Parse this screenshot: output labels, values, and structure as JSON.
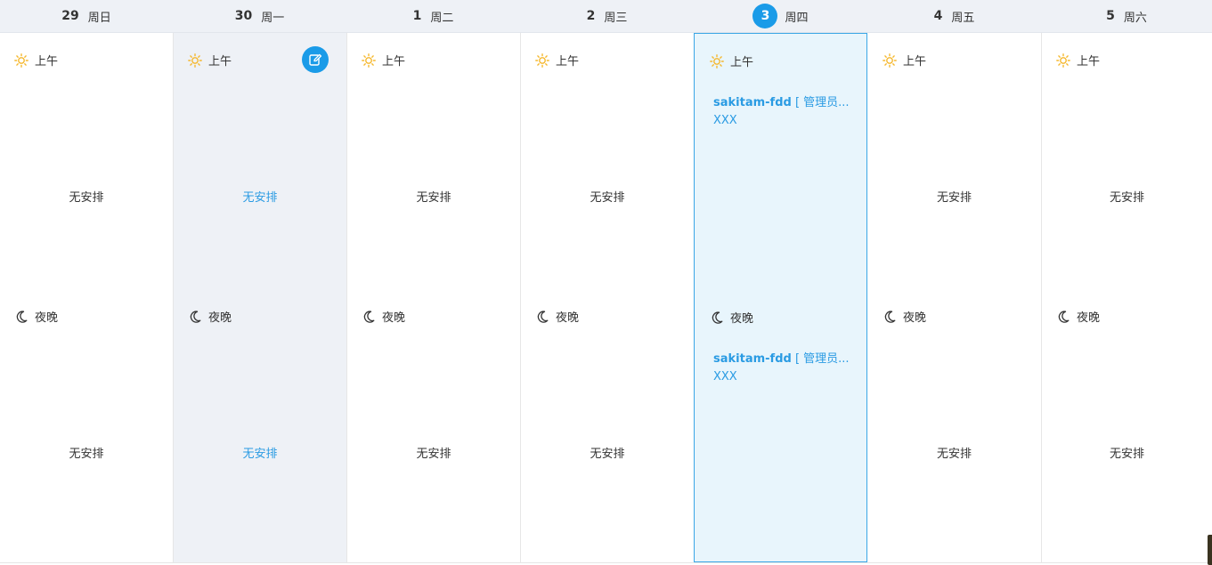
{
  "week": {
    "days": [
      {
        "num": "29",
        "weekday": "周日"
      },
      {
        "num": "30",
        "weekday": "周一"
      },
      {
        "num": "1",
        "weekday": "周二"
      },
      {
        "num": "2",
        "weekday": "周三"
      },
      {
        "num": "3",
        "weekday": "周四"
      },
      {
        "num": "4",
        "weekday": "周五"
      },
      {
        "num": "5",
        "weekday": "周六"
      }
    ]
  },
  "slots": {
    "morning_label": "上午",
    "evening_label": "夜晚",
    "empty_text": "无安排"
  },
  "entries": {
    "morning": {
      "name": "sakitam-fdd",
      "role": " [ 管理员...",
      "detail": "XXX"
    },
    "evening": {
      "name": "sakitam-fdd",
      "role": " [ 管理员...",
      "detail": "XXX"
    }
  },
  "icons": {
    "morning": "sun-icon",
    "evening": "moon-icon",
    "edit": "edit-icon"
  },
  "colors": {
    "accent": "#1a9be8",
    "link_text": "#2a9be3",
    "header_bg": "#eef1f6",
    "today_bg": "#e8f5fc",
    "sun": "#f5b82e"
  }
}
